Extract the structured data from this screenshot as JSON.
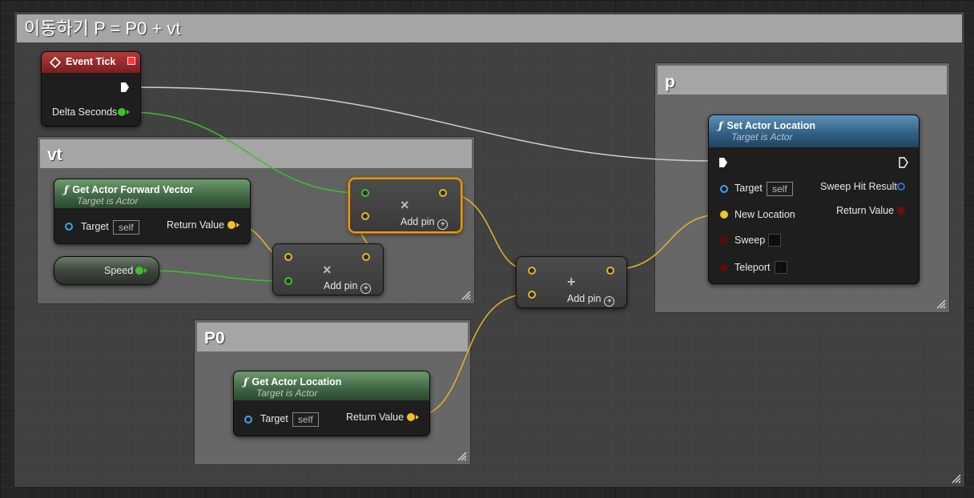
{
  "outer_comment": {
    "title": "이동하기 P = P0 + vt"
  },
  "comment_vt": {
    "title": "vt"
  },
  "comment_p0": {
    "title": "P0"
  },
  "comment_p": {
    "title": "p"
  },
  "event_tick": {
    "title": "Event Tick",
    "delta_label": "Delta Seconds"
  },
  "forward_vector": {
    "title": "Get Actor Forward Vector",
    "subtitle": "Target is Actor",
    "target_label": "Target",
    "target_value": "self",
    "return_label": "Return Value"
  },
  "speed_var": {
    "label": "Speed"
  },
  "multiply_1": {
    "symbol": "×",
    "add_pin": "Add pin"
  },
  "multiply_2": {
    "symbol": "×",
    "add_pin": "Add pin"
  },
  "add_node": {
    "symbol": "+",
    "add_pin": "Add pin"
  },
  "get_location": {
    "title": "Get Actor Location",
    "subtitle": "Target is Actor",
    "target_label": "Target",
    "target_value": "self",
    "return_label": "Return Value"
  },
  "set_location": {
    "title": "Set Actor Location",
    "subtitle": "Target is Actor",
    "target_label": "Target",
    "target_value": "self",
    "new_location_label": "New Location",
    "sweep_label": "Sweep",
    "teleport_label": "Teleport",
    "sweep_hit_label": "Sweep Hit Result",
    "return_label": "Return Value"
  },
  "colors": {
    "vector_pin": "#f2c12b",
    "float_pin": "#3ec02c",
    "object_pin": "#3ea4e8",
    "bool_pin": "#6b0f0f",
    "selection": "#e69a10"
  },
  "icons": {
    "function": "function-icon",
    "event": "event-diamond-icon",
    "exec": "exec-arrow-icon",
    "add": "add-circle-icon",
    "resize": "resize-grip-icon"
  }
}
